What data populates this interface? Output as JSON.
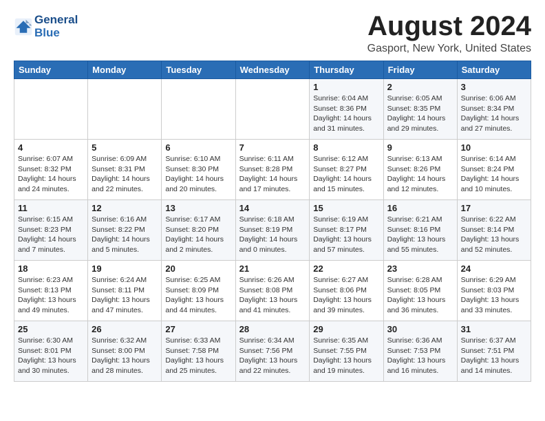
{
  "header": {
    "logo_line1": "General",
    "logo_line2": "Blue",
    "month_year": "August 2024",
    "location": "Gasport, New York, United States"
  },
  "weekdays": [
    "Sunday",
    "Monday",
    "Tuesday",
    "Wednesday",
    "Thursday",
    "Friday",
    "Saturday"
  ],
  "weeks": [
    [
      {
        "day": "",
        "detail": ""
      },
      {
        "day": "",
        "detail": ""
      },
      {
        "day": "",
        "detail": ""
      },
      {
        "day": "",
        "detail": ""
      },
      {
        "day": "1",
        "detail": "Sunrise: 6:04 AM\nSunset: 8:36 PM\nDaylight: 14 hours\nand 31 minutes."
      },
      {
        "day": "2",
        "detail": "Sunrise: 6:05 AM\nSunset: 8:35 PM\nDaylight: 14 hours\nand 29 minutes."
      },
      {
        "day": "3",
        "detail": "Sunrise: 6:06 AM\nSunset: 8:34 PM\nDaylight: 14 hours\nand 27 minutes."
      }
    ],
    [
      {
        "day": "4",
        "detail": "Sunrise: 6:07 AM\nSunset: 8:32 PM\nDaylight: 14 hours\nand 24 minutes."
      },
      {
        "day": "5",
        "detail": "Sunrise: 6:09 AM\nSunset: 8:31 PM\nDaylight: 14 hours\nand 22 minutes."
      },
      {
        "day": "6",
        "detail": "Sunrise: 6:10 AM\nSunset: 8:30 PM\nDaylight: 14 hours\nand 20 minutes."
      },
      {
        "day": "7",
        "detail": "Sunrise: 6:11 AM\nSunset: 8:28 PM\nDaylight: 14 hours\nand 17 minutes."
      },
      {
        "day": "8",
        "detail": "Sunrise: 6:12 AM\nSunset: 8:27 PM\nDaylight: 14 hours\nand 15 minutes."
      },
      {
        "day": "9",
        "detail": "Sunrise: 6:13 AM\nSunset: 8:26 PM\nDaylight: 14 hours\nand 12 minutes."
      },
      {
        "day": "10",
        "detail": "Sunrise: 6:14 AM\nSunset: 8:24 PM\nDaylight: 14 hours\nand 10 minutes."
      }
    ],
    [
      {
        "day": "11",
        "detail": "Sunrise: 6:15 AM\nSunset: 8:23 PM\nDaylight: 14 hours\nand 7 minutes."
      },
      {
        "day": "12",
        "detail": "Sunrise: 6:16 AM\nSunset: 8:22 PM\nDaylight: 14 hours\nand 5 minutes."
      },
      {
        "day": "13",
        "detail": "Sunrise: 6:17 AM\nSunset: 8:20 PM\nDaylight: 14 hours\nand 2 minutes."
      },
      {
        "day": "14",
        "detail": "Sunrise: 6:18 AM\nSunset: 8:19 PM\nDaylight: 14 hours\nand 0 minutes."
      },
      {
        "day": "15",
        "detail": "Sunrise: 6:19 AM\nSunset: 8:17 PM\nDaylight: 13 hours\nand 57 minutes."
      },
      {
        "day": "16",
        "detail": "Sunrise: 6:21 AM\nSunset: 8:16 PM\nDaylight: 13 hours\nand 55 minutes."
      },
      {
        "day": "17",
        "detail": "Sunrise: 6:22 AM\nSunset: 8:14 PM\nDaylight: 13 hours\nand 52 minutes."
      }
    ],
    [
      {
        "day": "18",
        "detail": "Sunrise: 6:23 AM\nSunset: 8:13 PM\nDaylight: 13 hours\nand 49 minutes."
      },
      {
        "day": "19",
        "detail": "Sunrise: 6:24 AM\nSunset: 8:11 PM\nDaylight: 13 hours\nand 47 minutes."
      },
      {
        "day": "20",
        "detail": "Sunrise: 6:25 AM\nSunset: 8:09 PM\nDaylight: 13 hours\nand 44 minutes."
      },
      {
        "day": "21",
        "detail": "Sunrise: 6:26 AM\nSunset: 8:08 PM\nDaylight: 13 hours\nand 41 minutes."
      },
      {
        "day": "22",
        "detail": "Sunrise: 6:27 AM\nSunset: 8:06 PM\nDaylight: 13 hours\nand 39 minutes."
      },
      {
        "day": "23",
        "detail": "Sunrise: 6:28 AM\nSunset: 8:05 PM\nDaylight: 13 hours\nand 36 minutes."
      },
      {
        "day": "24",
        "detail": "Sunrise: 6:29 AM\nSunset: 8:03 PM\nDaylight: 13 hours\nand 33 minutes."
      }
    ],
    [
      {
        "day": "25",
        "detail": "Sunrise: 6:30 AM\nSunset: 8:01 PM\nDaylight: 13 hours\nand 30 minutes."
      },
      {
        "day": "26",
        "detail": "Sunrise: 6:32 AM\nSunset: 8:00 PM\nDaylight: 13 hours\nand 28 minutes."
      },
      {
        "day": "27",
        "detail": "Sunrise: 6:33 AM\nSunset: 7:58 PM\nDaylight: 13 hours\nand 25 minutes."
      },
      {
        "day": "28",
        "detail": "Sunrise: 6:34 AM\nSunset: 7:56 PM\nDaylight: 13 hours\nand 22 minutes."
      },
      {
        "day": "29",
        "detail": "Sunrise: 6:35 AM\nSunset: 7:55 PM\nDaylight: 13 hours\nand 19 minutes."
      },
      {
        "day": "30",
        "detail": "Sunrise: 6:36 AM\nSunset: 7:53 PM\nDaylight: 13 hours\nand 16 minutes."
      },
      {
        "day": "31",
        "detail": "Sunrise: 6:37 AM\nSunset: 7:51 PM\nDaylight: 13 hours\nand 14 minutes."
      }
    ]
  ]
}
